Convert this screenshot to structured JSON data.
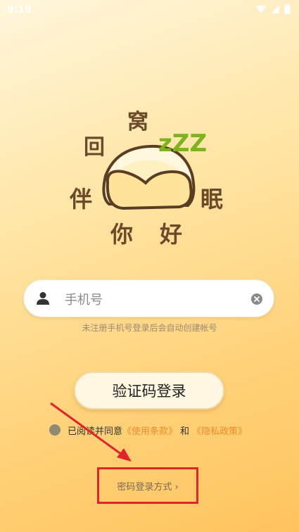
{
  "status_bar": {
    "time": "9:19"
  },
  "logo": {
    "chars": {
      "hui": "回",
      "wo": "窝",
      "ban": "伴",
      "mian": "眠",
      "ni": "你",
      "hao": "好"
    },
    "zzz": "zZZ"
  },
  "login": {
    "phone_placeholder": "手机号",
    "hint": "未注册手机号登录后会自动创建帐号",
    "code_login_label": "验证码登录",
    "agreement": {
      "prefix": "已阅读并同意",
      "terms": "《使用条款》",
      "and": "和",
      "privacy": "《隐私政策》"
    },
    "password_login_label": "密码登录方式 ›"
  },
  "colors": {
    "annotation": "#e3232a",
    "link": "#f08a2a"
  }
}
